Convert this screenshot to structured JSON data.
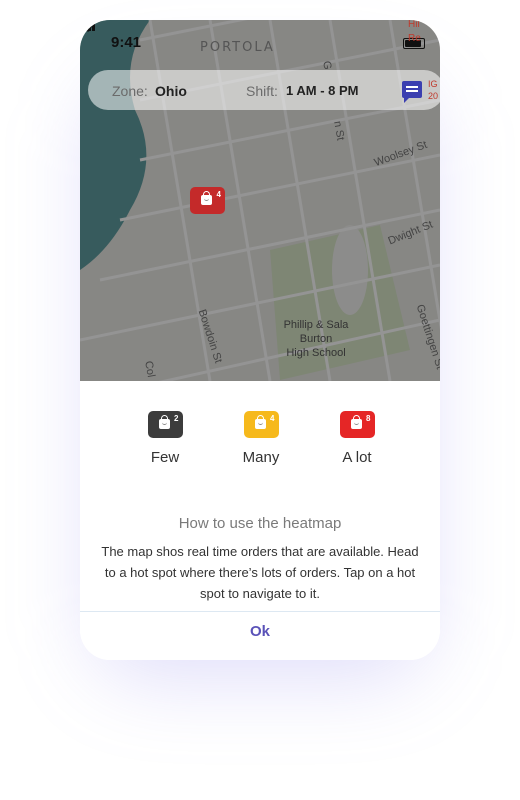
{
  "status_bar": {
    "time": "9:41"
  },
  "map": {
    "area_label": "PORTOLA",
    "streets": {
      "woolsey": "Woolsey St",
      "dwight": "Dwight St",
      "bowdoin": "Bowdoin St",
      "goettingen": "Goettingen St",
      "n_fragment": "n St",
      "g_fragment": "G",
      "col_fragment": "Col"
    },
    "school_name_line1": "Phillip & Sala Burton",
    "school_name_line2": "High School",
    "corner_top": "Hil",
    "corner_top2": "Re",
    "corner_right1": "IG",
    "corner_right2": "20",
    "hotspot_count": "4"
  },
  "topbar": {
    "zone_label": "Zone:",
    "zone_value": "Ohio",
    "shift_label": "Shift:",
    "shift_value": "1 AM - 8 PM",
    "chat_icon": "chat-icon"
  },
  "legend": {
    "few": {
      "label": "Few",
      "count": "2",
      "color": "#3c3c3c"
    },
    "many": {
      "label": "Many",
      "count": "4",
      "color": "#f6b91c"
    },
    "alot": {
      "label": "A lot",
      "count": "8",
      "color": "#e52626"
    }
  },
  "heatmap_help": {
    "title": "How to use the heatmap",
    "text": "The map shos real time orders that are available. Head to a hot spot where there’s lots of orders. Tap on a hot spot to navigate to it."
  },
  "ok_label": "Ok",
  "accent_color": "#5a52b8"
}
